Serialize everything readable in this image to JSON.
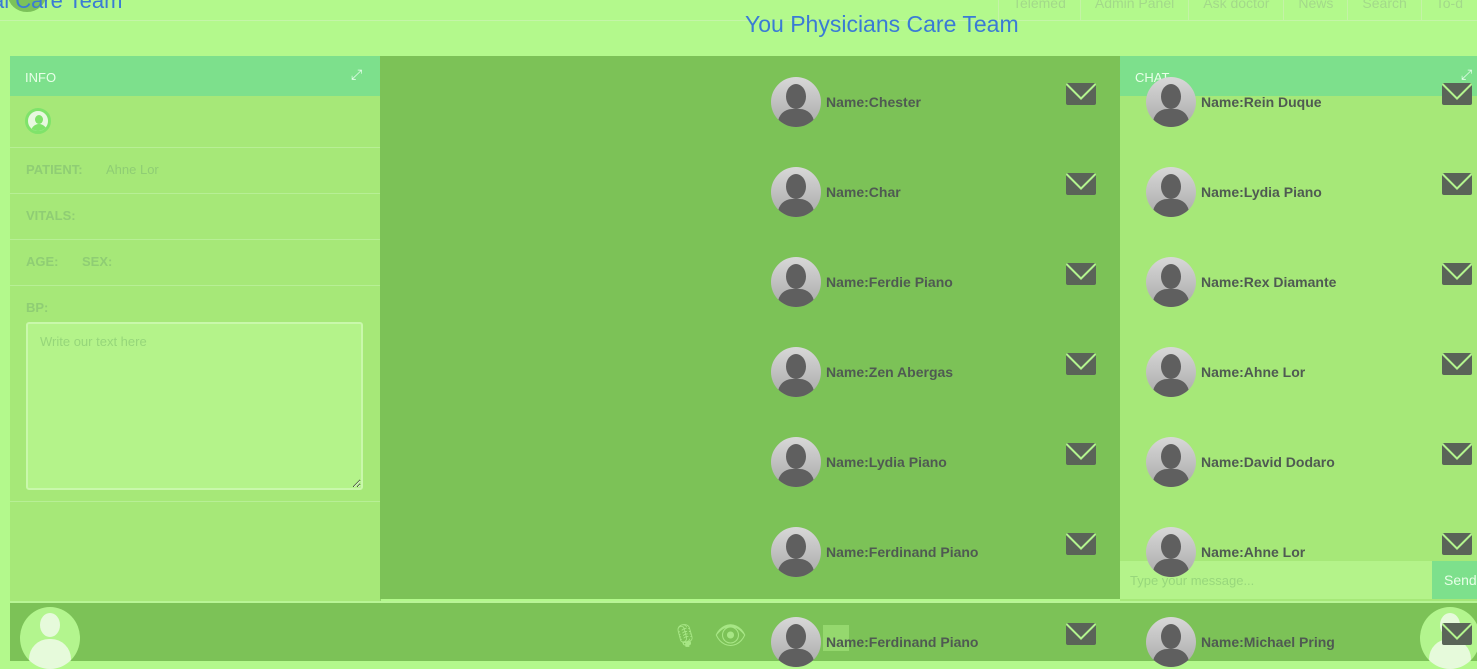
{
  "header": {
    "brand_text": "al Care Team",
    "title": "You Physicians Care Team",
    "nav": [
      "Telemed",
      "Admin Panel",
      "Ask doctor",
      "News",
      "Search",
      "To-d"
    ]
  },
  "info_panel": {
    "title": "INFO",
    "patient_label": "PATIENT:",
    "patient_value": "Ahne Lor",
    "vitals_label": "VITALS:",
    "age_label": "AGE:",
    "sex_label": "SEX:",
    "bp_label": "BP:",
    "note_placeholder": "Write our text here"
  },
  "chat_panel": {
    "title": "CHAT",
    "input_placeholder": "Type your message...",
    "send_label": "Send"
  },
  "doctors_left": [
    "Name:Chester",
    "Name:Char",
    "Name:Ferdie Piano",
    "Name:Zen Abergas",
    "Name:Lydia Piano",
    "Name:Ferdinand Piano",
    "Name:Ferdinand Piano"
  ],
  "doctors_right": [
    "Name:Rein Duque",
    "Name:Lydia Piano",
    "Name:Rex Diamante",
    "Name:Ahne Lor",
    "Name:David Dodaro",
    "Name:Ahne Lor",
    "Name:Michael Pring"
  ],
  "colors": {
    "background": "#b3f98c",
    "panel_header": "#7de08c",
    "video_area": "#7cc257",
    "title_blue": "#3a7bd5"
  },
  "icons": {
    "expand": "expand-icon",
    "mail": "envelope-icon",
    "mic": "microphone-icon",
    "eye": "eye-icon"
  }
}
